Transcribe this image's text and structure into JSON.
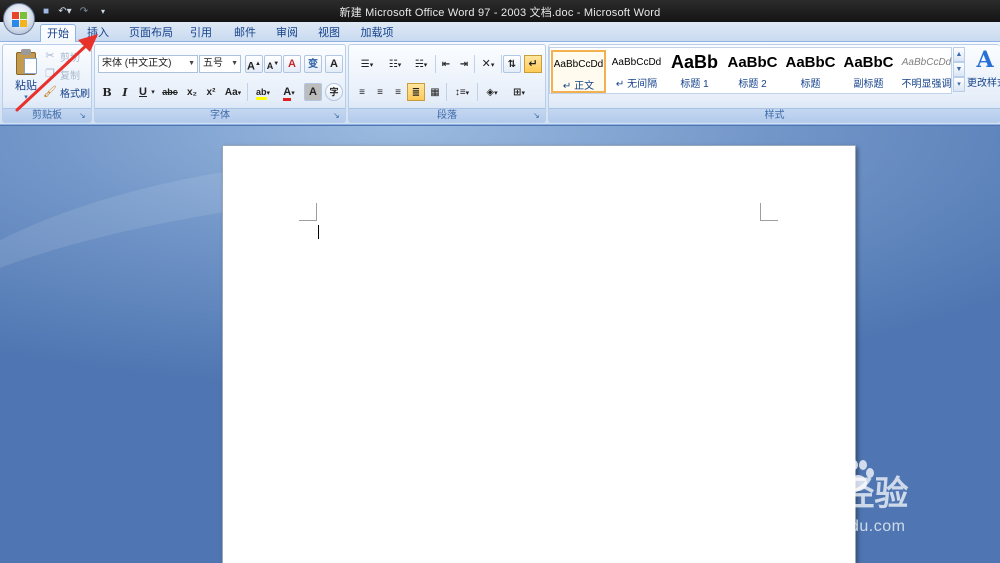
{
  "window": {
    "title": "新建 Microsoft Office Word 97 - 2003 文档.doc - Microsoft Word"
  },
  "quick_access": [
    "save-icon",
    "undo-icon",
    "redo-icon",
    "customize-icon"
  ],
  "tabs": [
    {
      "label": "开始",
      "active": true
    },
    {
      "label": "插入"
    },
    {
      "label": "页面布局"
    },
    {
      "label": "引用"
    },
    {
      "label": "邮件"
    },
    {
      "label": "审阅"
    },
    {
      "label": "视图"
    },
    {
      "label": "加载项"
    }
  ],
  "clipboard": {
    "group_label": "剪贴板",
    "paste_label": "粘贴",
    "cut_label": "剪切",
    "copy_label": "复制",
    "format_painter_label": "格式刷"
  },
  "font": {
    "group_label": "字体",
    "font_name": "宋体 (中文正文)",
    "font_size": "五号",
    "grow_label": "A",
    "shrink_label": "A",
    "clear_label": "A",
    "phonetic_label": "变",
    "border_label": "A",
    "bold_label": "B",
    "italic_label": "I",
    "underline_label": "U",
    "strike_label": "abc",
    "subscript_label": "x₂",
    "superscript_label": "x²",
    "case_label": "Aa",
    "highlight_label": "ab",
    "color_label": "A",
    "shading_label": "A",
    "enclose_label": "字"
  },
  "paragraph": {
    "group_label": "段落"
  },
  "styles": {
    "group_label": "样式",
    "items": [
      {
        "preview": "AaBbCcDd",
        "name": "↵ 正文",
        "selected": true
      },
      {
        "preview": "AaBbCcDd",
        "name": "↵ 无间隔"
      },
      {
        "preview": "AaBb",
        "name": "标题 1"
      },
      {
        "preview": "AaBbC",
        "name": "标题 2"
      },
      {
        "preview": "AaBbC",
        "name": "标题"
      },
      {
        "preview": "AaBbC",
        "name": "副标题"
      },
      {
        "preview": "AaBbCcDd",
        "name": "不明显强调"
      }
    ],
    "change_label": "更改样式"
  },
  "watermark": {
    "brand": "Bai  经验",
    "url": "jingyan.baidu.com"
  },
  "colors": {
    "accent": "#15428b",
    "annotation_arrow": "#e8312b",
    "font_color_bar": "#e01f1f",
    "highlight_bar": "#ffff00"
  }
}
